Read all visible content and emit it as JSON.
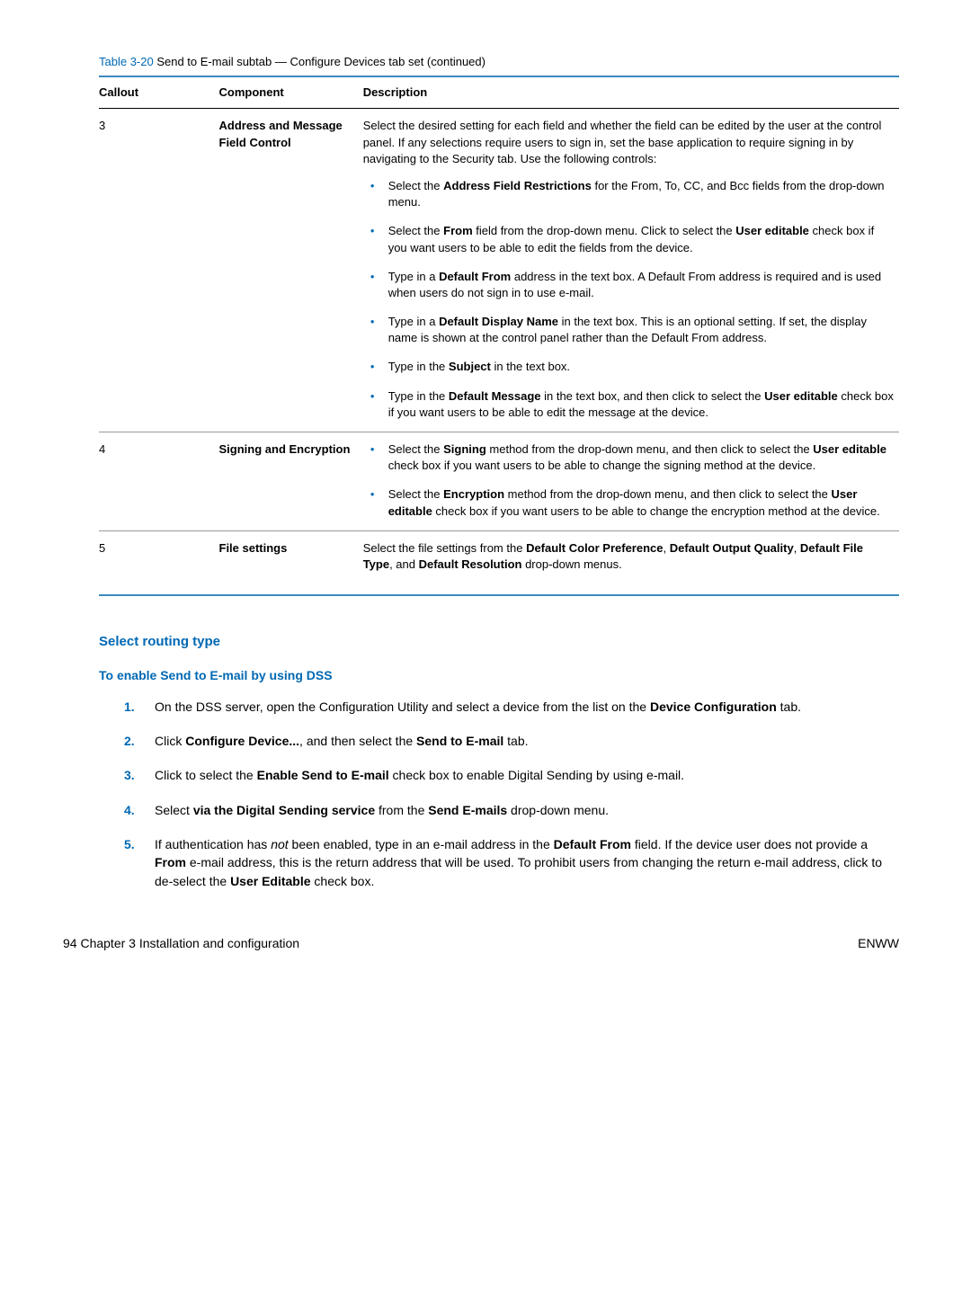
{
  "tableTitle": {
    "colored": "Table 3-20",
    "rest": "  Send to E-mail subtab — Configure Devices tab set (continued)"
  },
  "headers": {
    "c1": "Callout",
    "c2": "Component",
    "c3": "Description"
  },
  "rows": [
    {
      "callout": "3",
      "component": "Address and Message Field Control",
      "intro": "Select the desired setting for each field and whether the field can be edited by the user at the control panel. If any selections require users to sign in, set the base application to require signing in by navigating to the Security tab. Use the following controls:",
      "bullets": [
        "Select the <b>Address Field Restrictions</b> for the From, To, CC, and Bcc fields from the drop-down menu.",
        "Select the <b>From</b> field from the drop-down menu. Click to select the <b>User editable</b> check box if you want users to be able to edit the fields from the device.",
        "Type in a <b>Default From</b> address in the text box. A Default From address is required and is used when users do not sign in to use e-mail.",
        "Type in a <b>Default Display Name</b> in the text box. This is an optional setting. If set, the display name is shown at the control panel rather than the Default From address.",
        "Type in the <b>Subject</b> in the text box.",
        "Type in the <b>Default Message</b> in the text box, and then click to select the <b>User editable</b> check box if you want users to be able to edit the message at the device."
      ]
    },
    {
      "callout": "4",
      "component": "Signing and Encryption",
      "intro": "",
      "bullets": [
        "Select the <b>Signing</b> method from the drop-down menu, and then click to select the <b>User editable</b> check box if you want users to be able to change the signing method at the device.",
        "Select the <b>Encryption</b> method from the drop-down menu, and then click to select the <b>User editable</b> check box if you want users to be able to change the encryption method at the device."
      ]
    },
    {
      "callout": "5",
      "component": "File settings",
      "intro": "Select the file settings from the <b>Default Color Preference</b>, <b>Default Output Quality</b>, <b>Default File Type</b>, and <b>Default Resolution</b> drop-down menus.",
      "bullets": []
    }
  ],
  "section": {
    "h3": "Select routing type",
    "h4": "To enable Send to E-mail by using DSS",
    "steps": [
      "On the DSS server, open the Configuration Utility and select a device from the list on the <b>Device Configuration</b> tab.",
      "Click <b>Configure Device...</b>, and then select the <b>Send to E-mail</b> tab.",
      "Click to select the <b>Enable Send to E-mail</b> check box to enable Digital Sending by using e-mail.",
      "Select <b>via the Digital Sending service</b> from the <b>Send E-mails</b> drop-down menu.",
      "If authentication has <span class=\"italic\">not</span> been enabled, type in an e-mail address in the <b>Default From</b> field. If the device user does not provide a <b>From</b> e-mail address, this is the return address that will be used. To prohibit users from changing the return e-mail address, click to de-select the <b>User Editable</b> check box."
    ]
  },
  "footer": {
    "left": "94     Chapter 3   Installation and configuration",
    "right": "ENWW"
  }
}
